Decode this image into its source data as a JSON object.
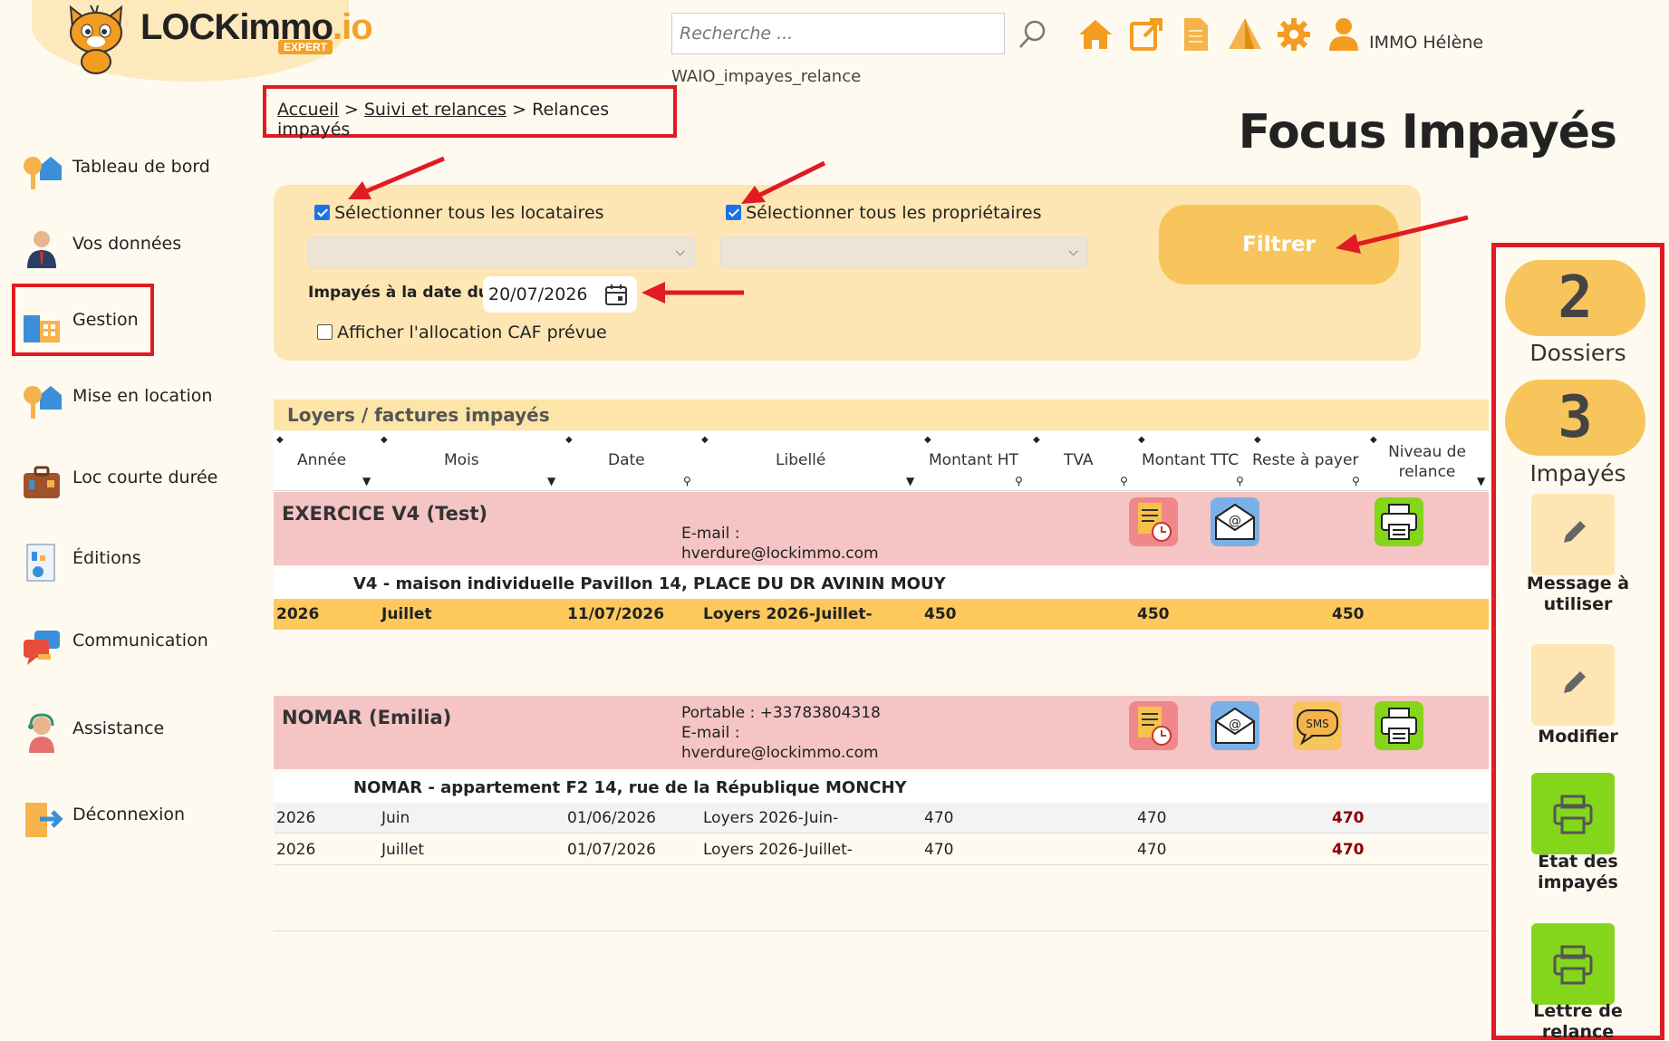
{
  "header": {
    "logo_text": "LOCKimmo",
    "logo_suffix": ".io",
    "logo_badge": "EXPERT",
    "search_placeholder": "Recherche ...",
    "username": "IMMO Hélène",
    "page_code": "WAIO_impayes_relance",
    "icons": [
      "home-icon",
      "external-link-icon",
      "document-icon",
      "tent-icon",
      "gear-icon",
      "user-icon"
    ]
  },
  "breadcrumb": {
    "items": [
      "Accueil",
      "Suivi et relances",
      "Relances impayés"
    ],
    "separator": ">"
  },
  "page_title": "Focus Impayés",
  "sidebar": {
    "items": [
      {
        "label": "Tableau de bord",
        "icon": "keys-house-icon"
      },
      {
        "label": "Vos données",
        "icon": "person-icon"
      },
      {
        "label": "Gestion",
        "icon": "building-icon"
      },
      {
        "label": "Mise en location",
        "icon": "keys-house-icon"
      },
      {
        "label": "Loc courte durée",
        "icon": "suitcase-icon"
      },
      {
        "label": "Éditions",
        "icon": "report-icon"
      },
      {
        "label": "Communication",
        "icon": "chat-icon"
      },
      {
        "label": "Assistance",
        "icon": "headset-icon"
      },
      {
        "label": "Déconnexion",
        "icon": "logout-icon"
      }
    ]
  },
  "filters": {
    "select_all_tenants": "Sélectionner tous les locataires",
    "select_all_owners": "Sélectionner tous les propriétaires",
    "date_label": "Impayés à la date  du :",
    "date_value": "20/07/2026",
    "show_caf": "Afficher l'allocation CAF prévue",
    "filter_button": "Filtrer",
    "tenants_checked": true,
    "owners_checked": true,
    "caf_checked": false
  },
  "table": {
    "section_title": "Loyers / factures impayés",
    "columns": [
      "Année",
      "Mois",
      "Date",
      "Libellé",
      "Montant HT",
      "TVA",
      "Montant TTC",
      "Reste à payer",
      "Niveau de relance"
    ],
    "groups": [
      {
        "name": "EXERCICE V4 (Test)",
        "phone_line": "",
        "email_label": "E-mail :",
        "email": "hverdure@lockimmo.com",
        "address": "V4 - maison individuelle Pavillon 14, PLACE DU DR AVININ MOUY",
        "actions": [
          "reminder-note-icon",
          "email-icon",
          "print-icon"
        ],
        "rows": [
          {
            "annee": "2026",
            "mois": "Juillet",
            "date": "11/07/2026",
            "libelle": "Loyers 2026-Juillet-",
            "ht": "450",
            "ttc": "450",
            "reste": "450"
          }
        ]
      },
      {
        "name": "NOMAR (Emilia)",
        "phone_line": "Portable : +33783804318",
        "email_label": "E-mail :",
        "email": "hverdure@lockimmo.com",
        "address": "NOMAR - appartement F2 14, rue de la République MONCHY",
        "actions": [
          "reminder-note-icon",
          "email-icon",
          "sms-icon",
          "print-icon"
        ],
        "rows": [
          {
            "annee": "2026",
            "mois": "Juin",
            "date": "01/06/2026",
            "libelle": "Loyers 2026-Juin-",
            "ht": "470",
            "ttc": "470",
            "reste": "470"
          },
          {
            "annee": "2026",
            "mois": "Juillet",
            "date": "01/07/2026",
            "libelle": "Loyers 2026-Juillet-",
            "ht": "470",
            "ttc": "470",
            "reste": "470"
          }
        ]
      }
    ]
  },
  "right_panel": {
    "dossiers_count": "2",
    "dossiers_label": "Dossiers",
    "impayes_count": "3",
    "impayes_label": "Impayés",
    "message_label": "Message à utiliser",
    "modifier_label": "Modifier",
    "etat_label": "Etat des impayés",
    "lettre_label": "Lettre de relance"
  },
  "colors": {
    "accent": "#f8c55c",
    "highlight_red": "#e01b24",
    "group_row": "#f5c4c4",
    "green_button": "#84d61a"
  }
}
